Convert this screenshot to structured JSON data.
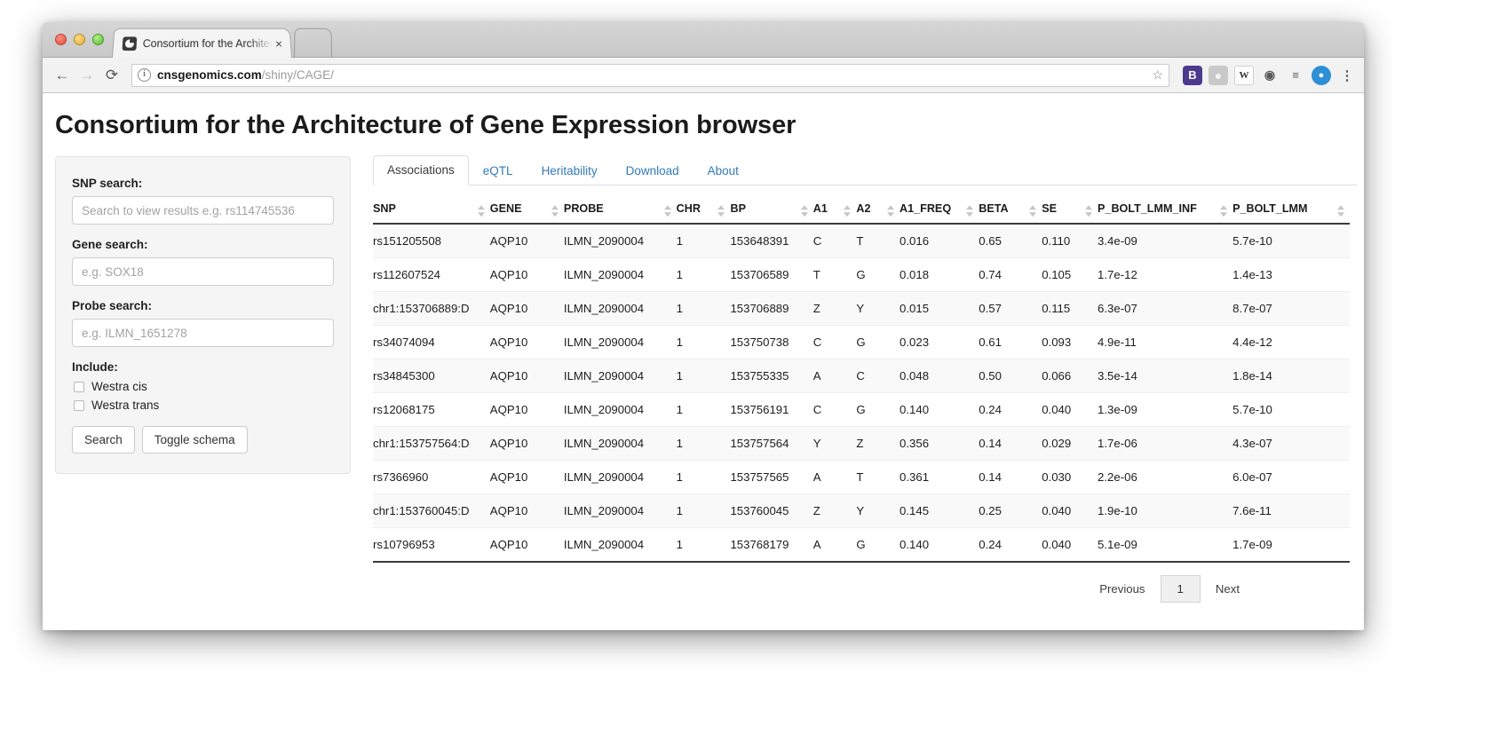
{
  "browser": {
    "tab_title": "Consortium for the Architectu",
    "tab_close_label": "×",
    "favicon_name": "cage-favicon",
    "back_label": "←",
    "forward_label": "→",
    "reload_label": "⟳",
    "info_label": "i",
    "url_domain": "cnsgenomics.com",
    "url_path": "/shiny/CAGE/",
    "star_label": "☆",
    "extensions": [
      {
        "name": "bitwarden-extension-icon",
        "label": "B",
        "kind": "bitwarden"
      },
      {
        "name": "shield-extension-icon",
        "label": "●",
        "kind": "shield"
      },
      {
        "name": "wikipedia-extension-icon",
        "label": "W",
        "kind": "wiki"
      },
      {
        "name": "screenshot-extension-icon",
        "label": "◉",
        "kind": "camera"
      },
      {
        "name": "reader-extension-icon",
        "label": "≡",
        "kind": "menu"
      },
      {
        "name": "pocket-extension-icon",
        "label": "●",
        "kind": "pocket"
      },
      {
        "name": "chrome-menu-icon",
        "label": "⋮",
        "kind": "kebab"
      }
    ],
    "profile_label": "☺",
    "maximize_label": "⤡"
  },
  "page": {
    "heading": "Consortium for the Architecture of Gene Expression browser"
  },
  "sidebar": {
    "snp_label": "SNP search:",
    "snp_placeholder": "Search to view results e.g. rs114745536",
    "snp_value": "",
    "gene_label": "Gene search:",
    "gene_placeholder": "e.g. SOX18",
    "gene_value": "",
    "probe_label": "Probe search:",
    "probe_placeholder": "e.g. ILMN_1651278",
    "probe_value": "",
    "include_label": "Include:",
    "checkboxes": [
      {
        "label": "Westra cis",
        "checked": false
      },
      {
        "label": "Westra trans",
        "checked": false
      }
    ],
    "search_button": "Search",
    "toggle_button": "Toggle schema"
  },
  "main": {
    "tabs": [
      {
        "label": "Associations",
        "active": true
      },
      {
        "label": "eQTL",
        "active": false
      },
      {
        "label": "Heritability",
        "active": false
      },
      {
        "label": "Download",
        "active": false
      },
      {
        "label": "About",
        "active": false
      }
    ],
    "table": {
      "columns": [
        "SNP",
        "GENE",
        "PROBE",
        "CHR",
        "BP",
        "A1",
        "A2",
        "A1_FREQ",
        "BETA",
        "SE",
        "P_BOLT_LMM_INF",
        "P_BOLT_LMM"
      ],
      "rows": [
        [
          "rs151205508",
          "AQP10",
          "ILMN_2090004",
          "1",
          "153648391",
          "C",
          "T",
          "0.016",
          "0.65",
          "0.110",
          "3.4e-09",
          "5.7e-10"
        ],
        [
          "rs112607524",
          "AQP10",
          "ILMN_2090004",
          "1",
          "153706589",
          "T",
          "G",
          "0.018",
          "0.74",
          "0.105",
          "1.7e-12",
          "1.4e-13"
        ],
        [
          "chr1:153706889:D",
          "AQP10",
          "ILMN_2090004",
          "1",
          "153706889",
          "Z",
          "Y",
          "0.015",
          "0.57",
          "0.115",
          "6.3e-07",
          "8.7e-07"
        ],
        [
          "rs34074094",
          "AQP10",
          "ILMN_2090004",
          "1",
          "153750738",
          "C",
          "G",
          "0.023",
          "0.61",
          "0.093",
          "4.9e-11",
          "4.4e-12"
        ],
        [
          "rs34845300",
          "AQP10",
          "ILMN_2090004",
          "1",
          "153755335",
          "A",
          "C",
          "0.048",
          "0.50",
          "0.066",
          "3.5e-14",
          "1.8e-14"
        ],
        [
          "rs12068175",
          "AQP10",
          "ILMN_2090004",
          "1",
          "153756191",
          "C",
          "G",
          "0.140",
          "0.24",
          "0.040",
          "1.3e-09",
          "5.7e-10"
        ],
        [
          "chr1:153757564:D",
          "AQP10",
          "ILMN_2090004",
          "1",
          "153757564",
          "Y",
          "Z",
          "0.356",
          "0.14",
          "0.029",
          "1.7e-06",
          "4.3e-07"
        ],
        [
          "rs7366960",
          "AQP10",
          "ILMN_2090004",
          "1",
          "153757565",
          "A",
          "T",
          "0.361",
          "0.14",
          "0.030",
          "2.2e-06",
          "6.0e-07"
        ],
        [
          "chr1:153760045:D",
          "AQP10",
          "ILMN_2090004",
          "1",
          "153760045",
          "Z",
          "Y",
          "0.145",
          "0.25",
          "0.040",
          "1.9e-10",
          "7.6e-11"
        ],
        [
          "rs10796953",
          "AQP10",
          "ILMN_2090004",
          "1",
          "153768179",
          "A",
          "G",
          "0.140",
          "0.24",
          "0.040",
          "5.1e-09",
          "1.7e-09"
        ]
      ]
    },
    "pagination": {
      "previous": "Previous",
      "current_page": "1",
      "next": "Next"
    }
  }
}
